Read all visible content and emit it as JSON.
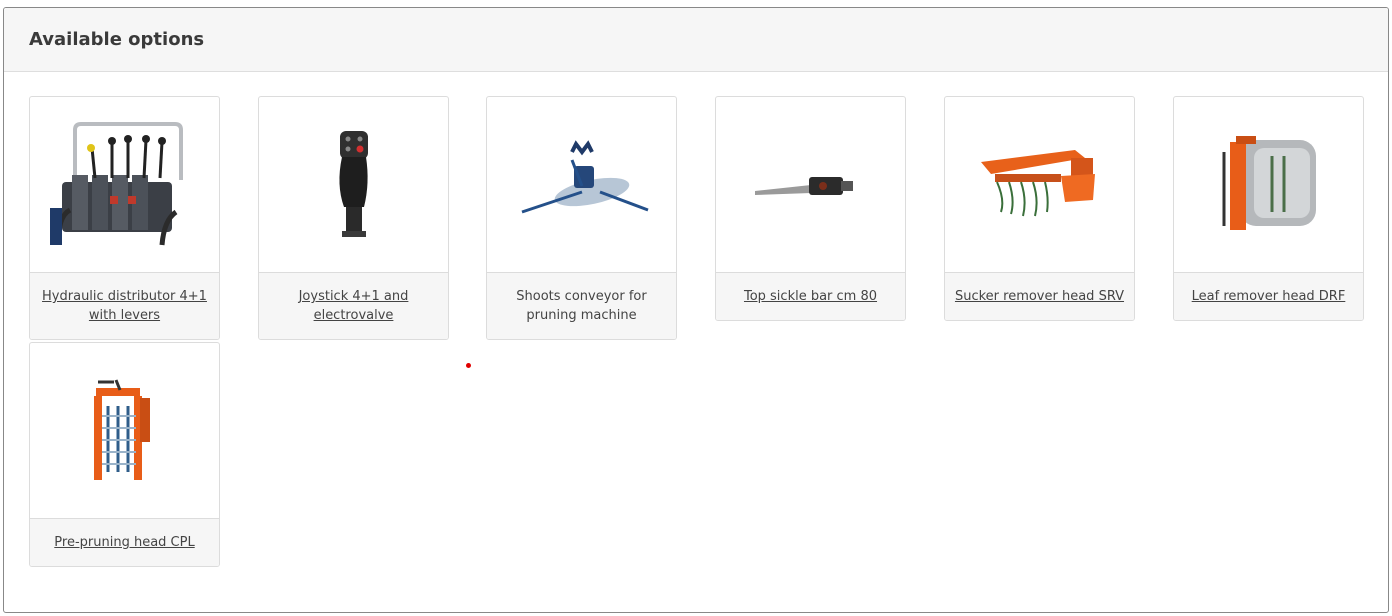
{
  "panel": {
    "title": "Available options"
  },
  "options": [
    {
      "label": "Hydraulic distributor 4+1 with levers",
      "linked": true,
      "icon": "hydraulic-distributor-image"
    },
    {
      "label": "Joystick 4+1 and electrovalve",
      "linked": true,
      "icon": "joystick-image"
    },
    {
      "label": "Shoots conveyor for pruning machine",
      "linked": false,
      "icon": "shoots-conveyor-image"
    },
    {
      "label": "Top sickle bar cm 80",
      "linked": true,
      "icon": "sickle-bar-image"
    },
    {
      "label": "Sucker remover head SRV",
      "linked": true,
      "icon": "sucker-remover-image"
    },
    {
      "label": "Leaf remover head DRF",
      "linked": true,
      "icon": "leaf-remover-image"
    },
    {
      "label": "Pre-pruning head CPL",
      "linked": true,
      "icon": "pre-pruning-head-image"
    }
  ]
}
